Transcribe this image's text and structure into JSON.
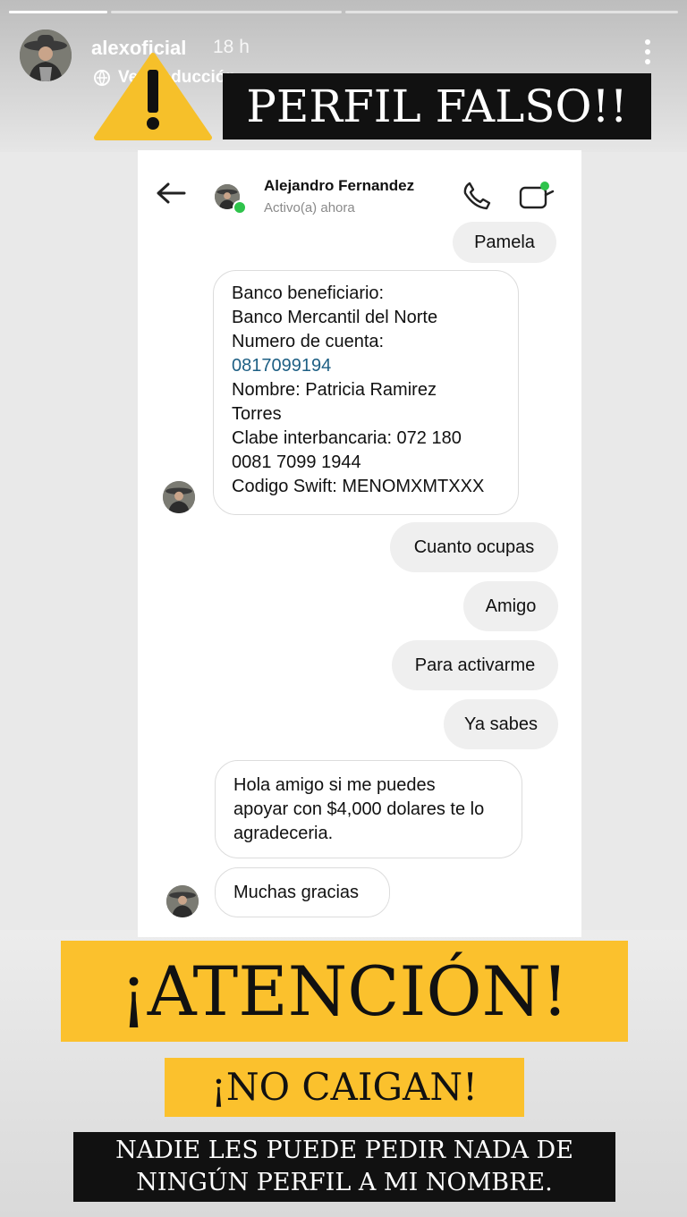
{
  "story": {
    "username": "alexoficial",
    "time_ago": "18 h",
    "translate_label": "Ver traducción",
    "progress_segments": [
      1.0,
      0.0
    ]
  },
  "overlays": {
    "warning_icon": "warning-triangle-icon",
    "perfil_falso": "PERFIL FALSO!!",
    "atencion": "¡ATENCIÓN!",
    "no_caigan": "¡NO CAIGAN!",
    "nadie_line1": "NADIE LES PUEDE PEDIR NADA DE",
    "nadie_line2": "NINGÚN PERFIL A MI NOMBRE."
  },
  "chat": {
    "contact_name": "Alejandro Fernandez",
    "contact_status": "Activo(a) ahora",
    "messages_out": {
      "pamela": "Pamela",
      "cuanto": "Cuanto ocupas",
      "amigo": "Amigo",
      "activarme": "Para activarme",
      "ya_sabes": "Ya sabes"
    },
    "bank_message": {
      "l1": "Banco beneficiario:",
      "l2": "Banco Mercantil del Norte",
      "l3": "Numero de cuenta:",
      "l4": "0817099194",
      "l5": "Nombre: Patricia Ramirez",
      "l6": "Torres",
      "l7": "Clabe interbancaria: 072 180",
      "l8": "0081 7099 1944",
      "l9": "Codigo Swift: MENOMXMTXXX"
    },
    "request_message": {
      "l1": "Hola amigo si me puedes",
      "l2": "apoyar con $4,000 dolares te lo",
      "l3": "agradeceria."
    },
    "thanks_message": "Muchas gracias"
  },
  "colors": {
    "yellow_banner": "#fbc12d",
    "black_banner": "#111111",
    "online_green": "#2ec34b",
    "link_blue": "#1d5f84"
  }
}
